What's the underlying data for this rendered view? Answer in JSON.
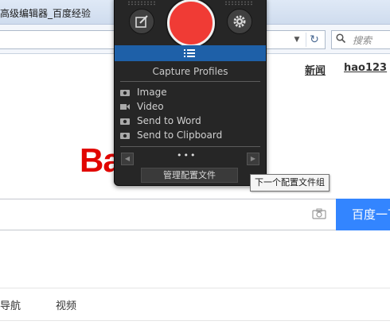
{
  "browser": {
    "title": "高级编辑器_百度经验",
    "search_placeholder": "搜索"
  },
  "page": {
    "top_links": [
      "新闻",
      "hao123"
    ],
    "logo_text": "Ba",
    "search_button": "百度一下",
    "bottom_links": [
      "导航",
      "视频"
    ]
  },
  "panel": {
    "profiles_title": "Capture Profiles",
    "profiles": [
      {
        "label": "Image",
        "icon": "camera-icon"
      },
      {
        "label": "Video",
        "icon": "video-icon"
      },
      {
        "label": "Send to Word",
        "icon": "camera-icon"
      },
      {
        "label": "Send to Clipboard",
        "icon": "camera-icon"
      }
    ],
    "pager_dots": "•••",
    "manage_button": "管理配置文件",
    "tooltip": "下一个配置文件组"
  },
  "colors": {
    "capture_red": "#f03b35",
    "profiles_bar_blue": "#1e60a8",
    "baidu_blue": "#3385ff",
    "logo_red": "#e10601"
  }
}
